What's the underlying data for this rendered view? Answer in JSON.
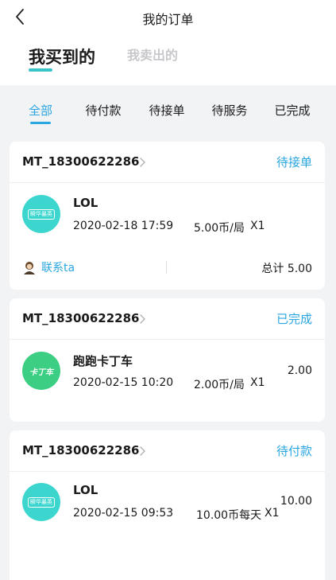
{
  "nav": {
    "title": "我的订单",
    "back_icon": "chevron-left-icon"
  },
  "segment": {
    "items": [
      {
        "label": "我买到的",
        "active": true
      },
      {
        "label": "我卖出的",
        "active": false
      }
    ]
  },
  "tabs": [
    {
      "label": "全部",
      "active": true
    },
    {
      "label": "待付款",
      "active": false
    },
    {
      "label": "待接单",
      "active": false
    },
    {
      "label": "待服务",
      "active": false
    },
    {
      "label": "已完成",
      "active": false
    }
  ],
  "colors": {
    "accent": "#2aa6e0",
    "segment_underline": "#3ac3c9",
    "lol_icon": "#3cd6cf",
    "kart_icon": "#3ccf84"
  },
  "orders": [
    {
      "order_no": "MT_18300622286",
      "status": "待接单",
      "game": "LOL",
      "icon": "game-badge-icon",
      "icon_text": "瞬华暴英",
      "date": "2020-02-18 17:59",
      "price": "5.00币/局",
      "qty": "X1",
      "contact_label": "联系ta",
      "total_label": "总计",
      "total": "5.00"
    },
    {
      "order_no": "MT_18300622286",
      "status": "已完成",
      "game": "跑跑卡丁车",
      "icon": "kart-game-icon",
      "icon_text": "卡丁车",
      "date": "2020-02-15 10:20",
      "price": "2.00币/局",
      "qty": "X1",
      "amount": "2.00"
    },
    {
      "order_no": "MT_18300622286",
      "status": "待付款",
      "game": "LOL",
      "icon": "game-badge-icon",
      "icon_text": "瞬华暴英",
      "date": "2020-02-15 09:53",
      "price": "10.00币每天",
      "qty": "X1",
      "amount": "10.00"
    }
  ]
}
